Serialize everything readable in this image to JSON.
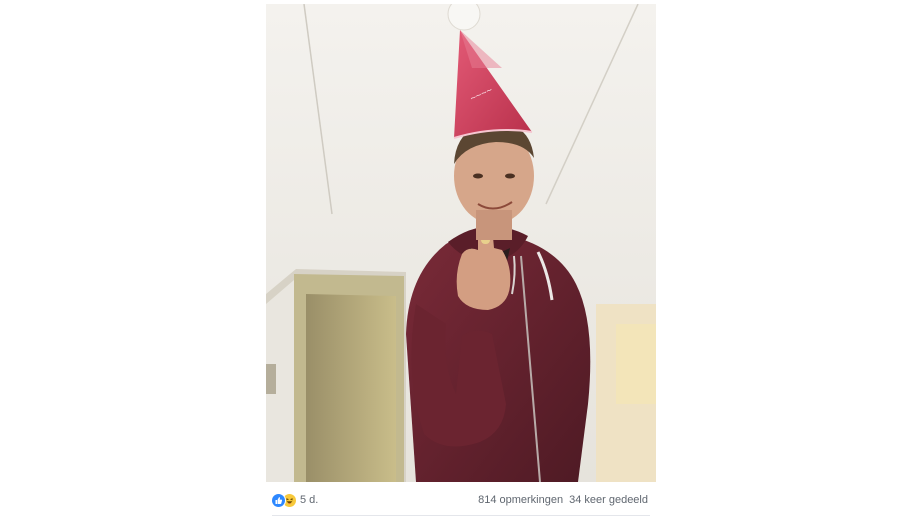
{
  "post": {
    "photo_icon": "photo-of-man-in-party-hat",
    "reactions": {
      "icons": [
        "like-icon",
        "haha-icon"
      ],
      "colors": {
        "like": "#2d88ff",
        "haha": "#f7c93b"
      }
    },
    "age": "5 d.",
    "comments": "814 opmerkingen",
    "shares": "34 keer gedeeld"
  },
  "colors": {
    "hoodie": "#6b2430",
    "hat": "#d8435f",
    "wall": "#efece6",
    "meta_text": "#606770"
  }
}
